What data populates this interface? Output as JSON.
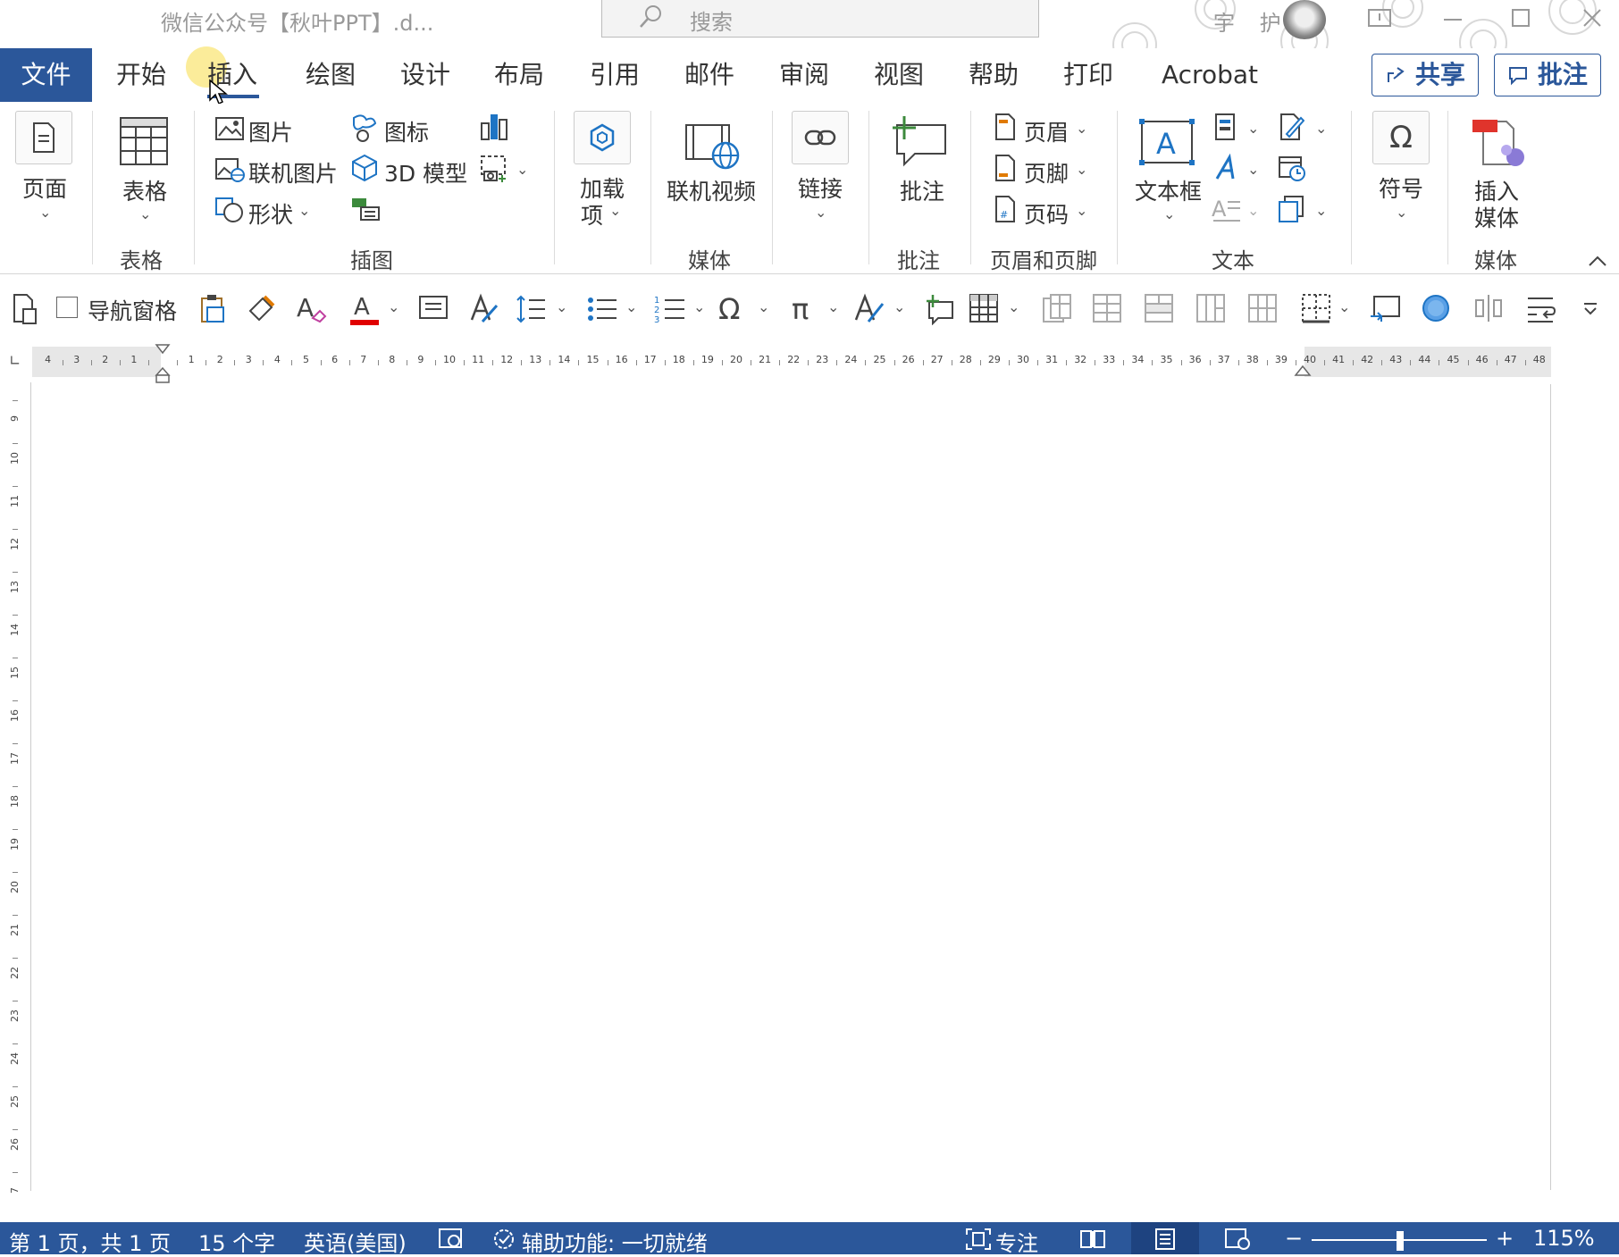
{
  "titlebar": {
    "doc_title": "微信公众号【秋叶PPT】.d...",
    "search_placeholder": "搜索",
    "user_name": "宇 护"
  },
  "tabs": {
    "file": "文件",
    "items": [
      "开始",
      "插入",
      "绘图",
      "设计",
      "布局",
      "引用",
      "邮件",
      "审阅",
      "视图",
      "帮助",
      "打印",
      "Acrobat"
    ],
    "active": "插入",
    "share": "共享",
    "comment": "批注"
  },
  "ribbon": {
    "page": "页面",
    "table": "表格",
    "group_table": "表格",
    "picture": "图片",
    "online_picture": "联机图片",
    "shapes": "形状",
    "icons": "图标",
    "models_3d": "3D 模型",
    "group_illustrations": "插图",
    "addins_line1": "加载",
    "addins_line2": "项",
    "online_video": "联机视频",
    "group_media": "媒体",
    "link": "链接",
    "comment": "批注",
    "group_comment": "批注",
    "header": "页眉",
    "footer": "页脚",
    "page_number": "页码",
    "group_header_footer": "页眉和页脚",
    "textbox": "文本框",
    "group_text": "文本",
    "symbol": "符号",
    "insert_media_line1": "插入",
    "insert_media_line2": "媒体",
    "group_media2": "媒体"
  },
  "toolbar": {
    "nav_pane": "导航窗格"
  },
  "ruler": {
    "h_left": [
      "4",
      "3",
      "2",
      "1"
    ],
    "h_right": [
      "1",
      "2",
      "3",
      "4",
      "5",
      "6",
      "7",
      "8",
      "9",
      "10",
      "11",
      "12",
      "13",
      "14",
      "15",
      "16",
      "17",
      "18",
      "19",
      "20",
      "21",
      "22",
      "23",
      "24",
      "25",
      "26",
      "27",
      "28",
      "29",
      "30",
      "31",
      "32",
      "33",
      "34",
      "35",
      "36",
      "37",
      "38",
      "39",
      "40",
      "41",
      "42",
      "43",
      "44",
      "45",
      "46",
      "47",
      "48"
    ],
    "v": [
      "9",
      "10",
      "11",
      "12",
      "13",
      "14",
      "15",
      "16",
      "17",
      "18",
      "19",
      "20",
      "21",
      "22",
      "23",
      "24",
      "25",
      "26",
      "7"
    ]
  },
  "status": {
    "page": "第 1 页，共 1 页",
    "words": "15 个字",
    "language": "英语(美国)",
    "accessibility": "辅助功能: 一切就绪",
    "focus": "专注",
    "zoom": "115%"
  },
  "colors": {
    "accent": "#2b579a",
    "font_red": "#e00000"
  }
}
